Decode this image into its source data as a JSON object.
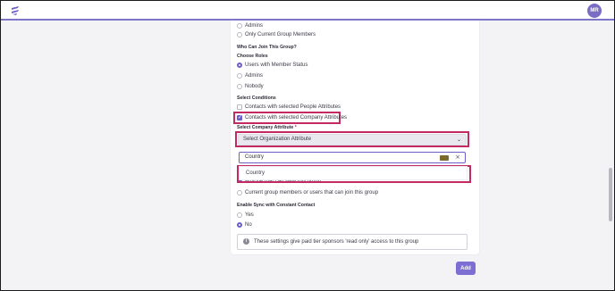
{
  "header": {
    "avatar_initials": "MR",
    "accent_color": "#6c5fc7"
  },
  "who_can_view": {
    "options": [
      "Admins",
      "Only Current Group Members"
    ]
  },
  "join_section": {
    "heading": "Who Can Join This Group?",
    "roles_heading": "Choose Roles",
    "roles": [
      "Users with Member Status",
      "Admins",
      "Nobody"
    ],
    "selected_role": "Users with Member Status"
  },
  "conditions": {
    "heading": "Select Conditions",
    "people_attr_label": "Contacts with selected People Attributes",
    "company_attr_label": "Contacts with selected Company Attributes",
    "company_attr_checked": true
  },
  "company_attribute": {
    "label": "Select Company Attribute",
    "required_mark": "*",
    "select_value": "Select Organization Attribute",
    "search_value": "Country",
    "dropdown_option": "Country"
  },
  "visibility": {
    "partial_option": "Anyone that can view this group",
    "members_option": "Current group members or users that can join this group"
  },
  "sync": {
    "heading": "Enable Sync with Constant Contact",
    "options": [
      "Yes",
      "No"
    ],
    "selected": "No"
  },
  "info_note": "These settings give paid tier sponsors 'read only' access to this group",
  "add_button": "Add"
}
